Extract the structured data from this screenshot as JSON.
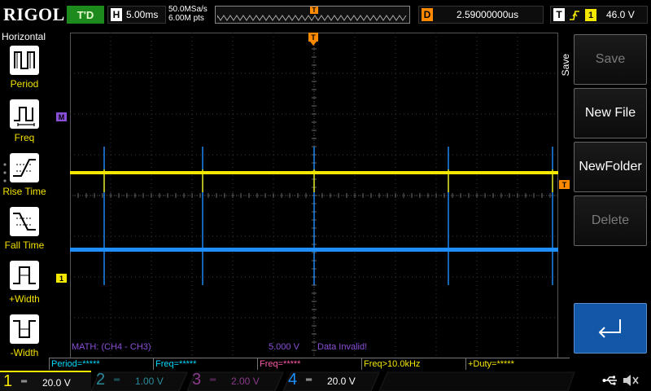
{
  "topbar": {
    "logo": "RIGOL",
    "run_status": "T'D",
    "horizontal_letter": "H",
    "timebase": "5.00ms",
    "sample_rate": "50.0MSa/s",
    "memory_depth": "6.00M pts",
    "delay_letter": "D",
    "delay": "2.59000000us",
    "trigger_letter": "T",
    "trigger_source": "1",
    "trigger_level": "46.0 V",
    "trigger_mark": "T"
  },
  "leftmenu": {
    "title": "Horizontal",
    "items": [
      {
        "label": "Period",
        "icon": "period-icon"
      },
      {
        "label": "Freq",
        "icon": "freq-icon"
      },
      {
        "label": "Rise Time",
        "icon": "rise-time-icon"
      },
      {
        "label": "Fall Time",
        "icon": "fall-time-icon"
      },
      {
        "label": "+Width",
        "icon": "positive-width-icon"
      },
      {
        "label": "-Width",
        "icon": "negative-width-icon"
      }
    ]
  },
  "display": {
    "math_marker": "M",
    "ch1_marker": "1",
    "trigger_level_marker": "T",
    "math_label": "MATH: (CH4 - CH3)",
    "math_scale": "5.000 V",
    "math_status": "Data Invalid!"
  },
  "measurements": [
    {
      "text": "Period=*****",
      "color": "cyan"
    },
    {
      "text": "Freq=*****",
      "color": "cyan"
    },
    {
      "text": "Freq=*****",
      "color": "pink"
    },
    {
      "text": "Freq>10.0kHz",
      "color": "yellow"
    },
    {
      "text": "+Duty=*****",
      "color": "yellow"
    }
  ],
  "channels": [
    {
      "num": "1",
      "coupling": "═",
      "scale": "20.0 V",
      "active": true,
      "color": "#f5e800"
    },
    {
      "num": "2",
      "coupling": "═",
      "scale": "1.00 V",
      "active": false,
      "color": "#2a8a9a"
    },
    {
      "num": "3",
      "coupling": "═",
      "scale": "2.00 V",
      "active": false,
      "color": "#8a3a8a"
    },
    {
      "num": "4",
      "coupling": "═",
      "scale": "20.0 V",
      "active": true,
      "color": "#1f8fff"
    }
  ],
  "rightpanel": {
    "title": "Save",
    "keys": [
      {
        "label": "Save",
        "enabled": false
      },
      {
        "label": "New File",
        "enabled": true
      },
      {
        "label": "NewFolder",
        "enabled": true
      },
      {
        "label": "Delete",
        "enabled": false
      },
      {
        "label": "",
        "icon": "return-arrow-icon"
      }
    ]
  },
  "colors": {
    "ch1": "#f5e800",
    "ch4": "#1f8fff",
    "math": "#8a4fd8",
    "trigger": "#ff8a00"
  }
}
